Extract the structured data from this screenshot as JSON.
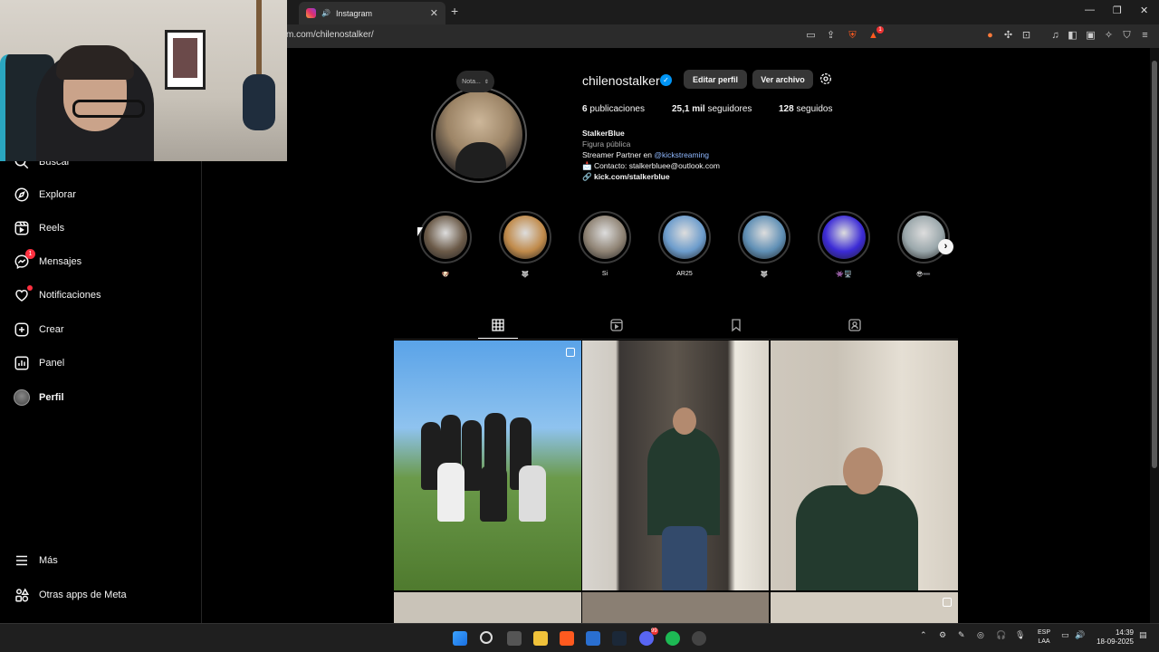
{
  "browser": {
    "tab_title": "Instagram",
    "url": "m.com/chilenostalker/",
    "brave_badge": "1"
  },
  "sidebar": {
    "items": [
      {
        "label": "Buscar"
      },
      {
        "label": "Explorar"
      },
      {
        "label": "Reels"
      },
      {
        "label": "Mensajes",
        "badge": "1"
      },
      {
        "label": "Notificaciones"
      },
      {
        "label": "Crear"
      },
      {
        "label": "Panel"
      },
      {
        "label": "Perfil"
      }
    ],
    "more": "Más",
    "meta_apps": "Otras apps de Meta"
  },
  "profile": {
    "note": "Nota...",
    "username": "chilenostalker",
    "edit_button": "Editar perfil",
    "archive_button": "Ver archivo",
    "stats": {
      "posts_num": "6",
      "posts_label": "publicaciones",
      "followers_num": "25,1 mil",
      "followers_label": "seguidores",
      "following_num": "128",
      "following_label": "seguidos"
    },
    "bio": {
      "name": "StalkerBlue",
      "category": "Figura pública",
      "line1_prefix": "Streamer Partner en ",
      "line1_mention": "@kickstreaming",
      "line2": "📩 Contacto: stalkerbluee@outlook.com",
      "link": "kick.com/stalkerblue"
    }
  },
  "highlights": [
    {
      "label": "🐶",
      "color": "#6b5a48"
    },
    {
      "label": "🐺",
      "color": "#c08a4a"
    },
    {
      "label": "Si",
      "color": "#8f8374"
    },
    {
      "label": "AR25",
      "color": "#6c9ccc"
    },
    {
      "label": "🐺",
      "color": "#5f8fb5"
    },
    {
      "label": "👾🖥️",
      "color": "#3b2ad6"
    },
    {
      "label": "😎➖",
      "color": "#9aa7ab"
    }
  ],
  "taskbar": {
    "lang_top": "ESP",
    "lang_bottom": "LAA",
    "time": "14:39",
    "date": "18-09-2025",
    "discord_badge": "99"
  },
  "colors": {
    "accent_blue": "#0095f6",
    "badge_red": "#ff3040"
  }
}
